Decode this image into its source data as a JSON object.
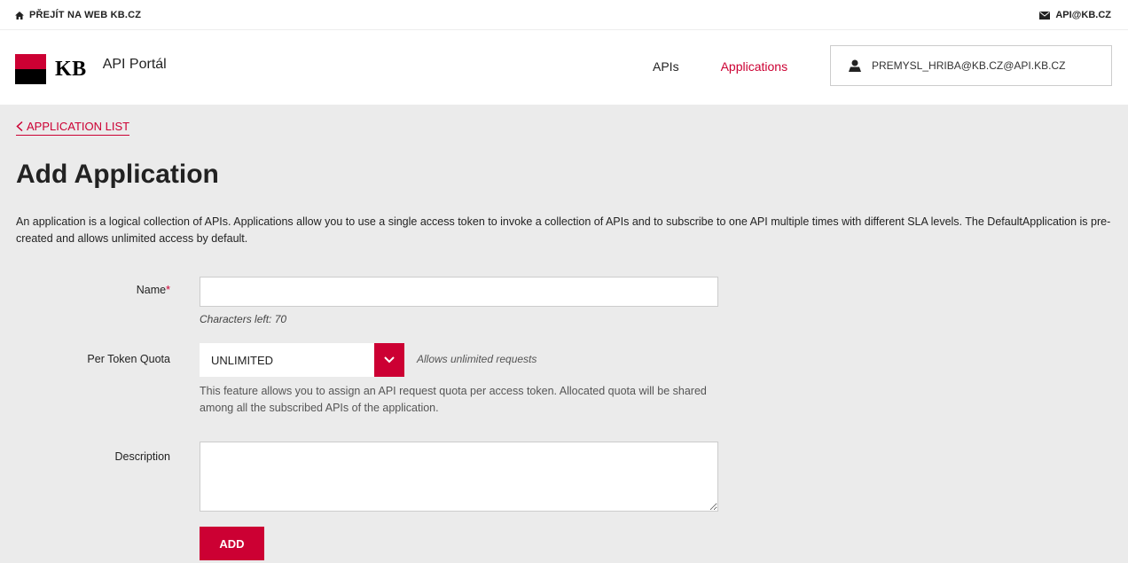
{
  "topbar": {
    "home_link": "PŘEJÍT NA WEB KB.CZ",
    "email_link": "API@KB.CZ"
  },
  "header": {
    "brand": "KB",
    "portal_name": "API Portál",
    "nav": [
      {
        "label": "APIs",
        "active": false
      },
      {
        "label": "Applications",
        "active": true
      }
    ],
    "user": "PREMYSL_HRIBA@KB.CZ@API.KB.CZ"
  },
  "main": {
    "back_link": "APPLICATION LIST",
    "title": "Add Application",
    "intro": "An application is a logical collection of APIs. Applications allow you to use a single access token to invoke a collection of APIs and to subscribe to one API multiple times with different SLA levels. The DefaultApplication is pre-created and allows unlimited access by default.",
    "form": {
      "name_label": "Name",
      "name_required_mark": "*",
      "name_value": "",
      "chars_left": "Characters left: 70",
      "quota_label": "Per Token Quota",
      "quota_value": "UNLIMITED",
      "quota_hint": "Allows unlimited requests",
      "quota_help": "This feature allows you to assign an API request quota per access token. Allocated quota will be shared among all the subscribed APIs of the application.",
      "description_label": "Description",
      "description_value": "",
      "submit_label": "ADD"
    }
  },
  "colors": {
    "accent": "#cc0033",
    "background": "#ebebeb",
    "header_bg": "#ffffff"
  },
  "icons": {
    "home": "home-icon",
    "mail": "mail-icon",
    "user": "user-icon",
    "back": "chevron-left-icon",
    "dropdown": "chevron-down-icon"
  }
}
